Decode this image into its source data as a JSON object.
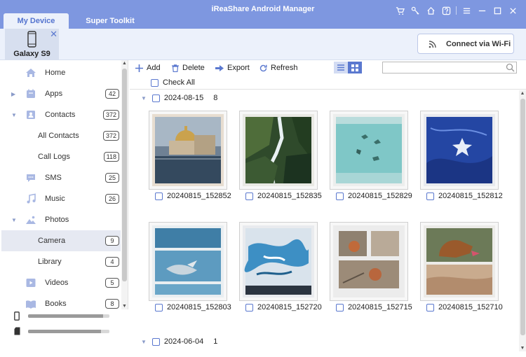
{
  "window": {
    "title": "iReaShare Android Manager",
    "tabs": [
      {
        "label": "My Device"
      },
      {
        "label": "Super Toolkit"
      }
    ],
    "icons": [
      "cart-icon",
      "key-icon",
      "home-icon",
      "help-icon",
      "menu-icon",
      "minimize-icon",
      "maximize-icon",
      "close-icon"
    ]
  },
  "device": {
    "name": "Galaxy S9",
    "wifi_button": "Connect via Wi-Fi"
  },
  "sidebar": {
    "items": [
      {
        "label": "Home",
        "icon": "home-icon"
      },
      {
        "label": "Apps",
        "count": "42",
        "icon": "apps-icon"
      },
      {
        "label": "Contacts",
        "count": "372",
        "icon": "contacts-icon"
      },
      {
        "label": "All Contacts",
        "count": "372"
      },
      {
        "label": "Call Logs",
        "count": "118"
      },
      {
        "label": "SMS",
        "count": "25",
        "icon": "sms-icon"
      },
      {
        "label": "Music",
        "count": "26",
        "icon": "music-icon"
      },
      {
        "label": "Photos",
        "icon": "photos-icon"
      },
      {
        "label": "Camera",
        "count": "9"
      },
      {
        "label": "Library",
        "count": "4"
      },
      {
        "label": "Videos",
        "count": "5",
        "icon": "videos-icon"
      },
      {
        "label": "Books",
        "count": "8",
        "icon": "books-icon"
      }
    ],
    "storage": [
      {
        "used_fraction": 0.92
      },
      {
        "used_fraction": 0.9
      }
    ]
  },
  "toolbar": {
    "add": "Add",
    "delete": "Delete",
    "export": "Export",
    "refresh": "Refresh",
    "check_all": "Check All",
    "search_placeholder": ""
  },
  "groups": [
    {
      "date": "2024-08-15",
      "count": "8",
      "photos": [
        {
          "name": "20240815_152852"
        },
        {
          "name": "20240815_152835"
        },
        {
          "name": "20240815_152829"
        },
        {
          "name": "20240815_152812"
        },
        {
          "name": "20240815_152803"
        },
        {
          "name": "20240815_152720"
        },
        {
          "name": "20240815_152715"
        },
        {
          "name": "20240815_152710"
        }
      ]
    },
    {
      "date": "2024-06-04",
      "count": "1"
    }
  ]
}
